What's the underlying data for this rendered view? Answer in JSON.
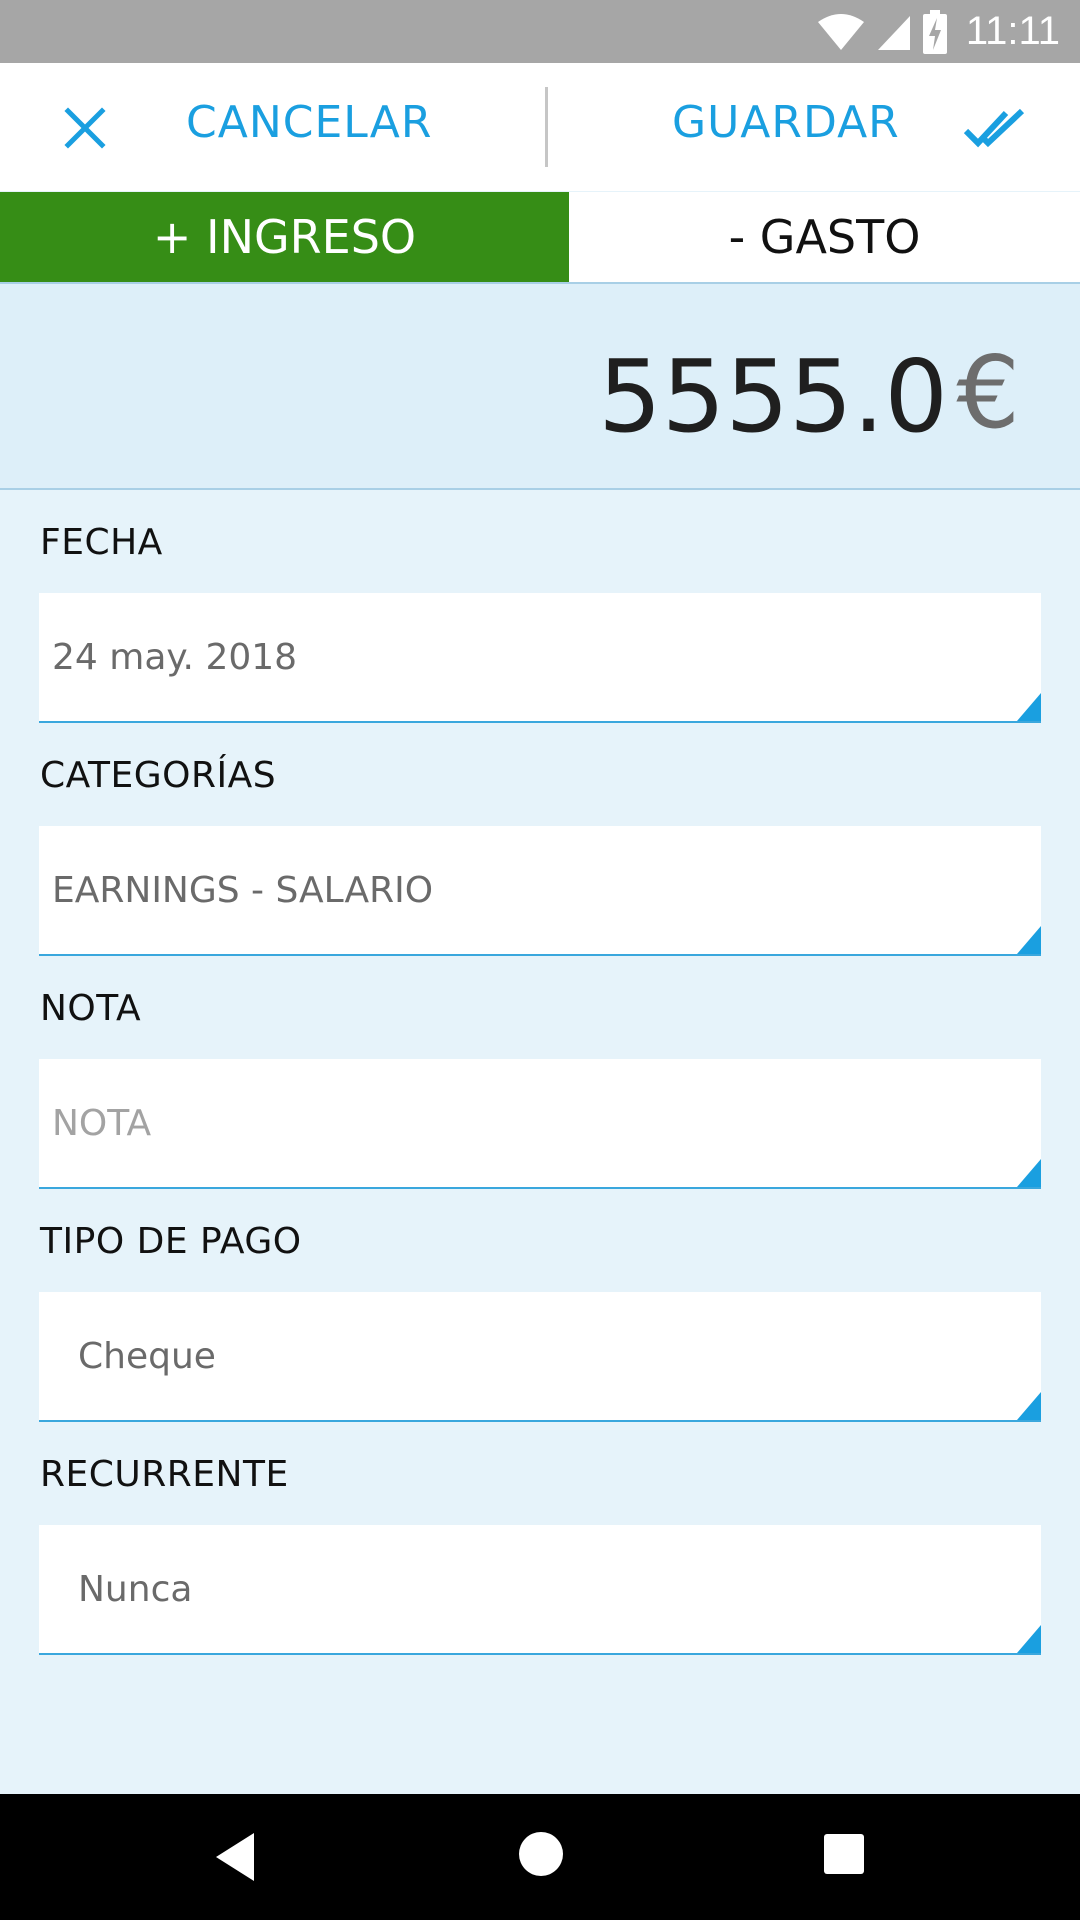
{
  "status_bar": {
    "time": "11:11",
    "icons": [
      "wifi-icon",
      "signal-icon",
      "battery-charging-icon"
    ]
  },
  "action_bar": {
    "cancel_icon": "close-icon",
    "cancel_label": "CANCELAR",
    "save_label": "GUARDAR",
    "save_icon": "double-check-icon",
    "accent_color": "#1a9fe0"
  },
  "type_toggle": {
    "income_label": "+ INGRESO",
    "expense_label": "- GASTO",
    "selected": "income",
    "income_color": "#368d16"
  },
  "amount": {
    "value": "5555.0",
    "currency": "€"
  },
  "fields": {
    "date": {
      "label": "FECHA",
      "value": "24 may. 2018"
    },
    "categories": {
      "label": "CATEGORÍAS",
      "value": "EARNINGS - SALARIO"
    },
    "note": {
      "label": "NOTA",
      "placeholder": "NOTA"
    },
    "payment_type": {
      "label": "TIPO DE PAGO",
      "value": "Cheque"
    },
    "recurring": {
      "label": "RECURRENTE",
      "value": "Nunca"
    }
  },
  "nav_bar": {
    "icons": [
      "back-icon",
      "home-icon",
      "recents-icon"
    ]
  }
}
